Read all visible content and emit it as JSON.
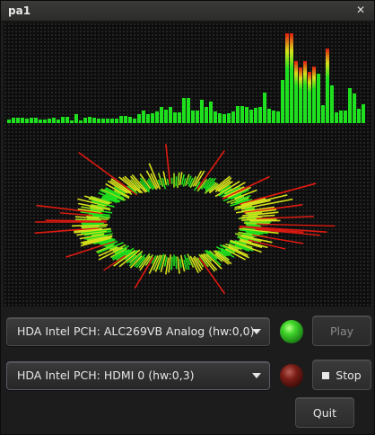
{
  "window": {
    "title": "pa1",
    "close_glyph": "✕"
  },
  "spectrum": {
    "bars": [
      0.04,
      0.06,
      0.06,
      0.06,
      0.05,
      0.06,
      0.06,
      0.04,
      0.04,
      0.05,
      0.06,
      0.04,
      0.07,
      0.07,
      0.03,
      0.1,
      0.03,
      0.06,
      0.07,
      0.06,
      0.05,
      0.05,
      0.05,
      0.05,
      0.05,
      0.08,
      0.08,
      0.07,
      0.05,
      0.1,
      0.14,
      0.1,
      0.11,
      0.13,
      0.18,
      0.15,
      0.18,
      0.12,
      0.12,
      0.28,
      0.28,
      0.14,
      0.14,
      0.26,
      0.18,
      0.24,
      0.13,
      0.11,
      0.1,
      0.11,
      0.13,
      0.19,
      0.19,
      0.18,
      0.15,
      0.17,
      0.18,
      0.34,
      0.16,
      0.14,
      0.13,
      0.48,
      1.0,
      1.0,
      0.69,
      0.62,
      0.69,
      0.57,
      0.63,
      0.55,
      0.2,
      0.83,
      0.42,
      0.12,
      0.14,
      0.14,
      0.39,
      0.33,
      0.16,
      0.21
    ],
    "colors": {
      "low": "#1ee01e",
      "mid": "#d8e21a",
      "high": "#e01a10"
    }
  },
  "device_output": {
    "label": "HDA Intel PCH: ALC269VB Analog (hw:0,0)",
    "led": "green"
  },
  "device_input": {
    "label": "HDA Intel PCH: HDMI 0 (hw:0,3)",
    "led": "red"
  },
  "buttons": {
    "play": "Play",
    "stop": "Stop",
    "quit": "Quit"
  }
}
